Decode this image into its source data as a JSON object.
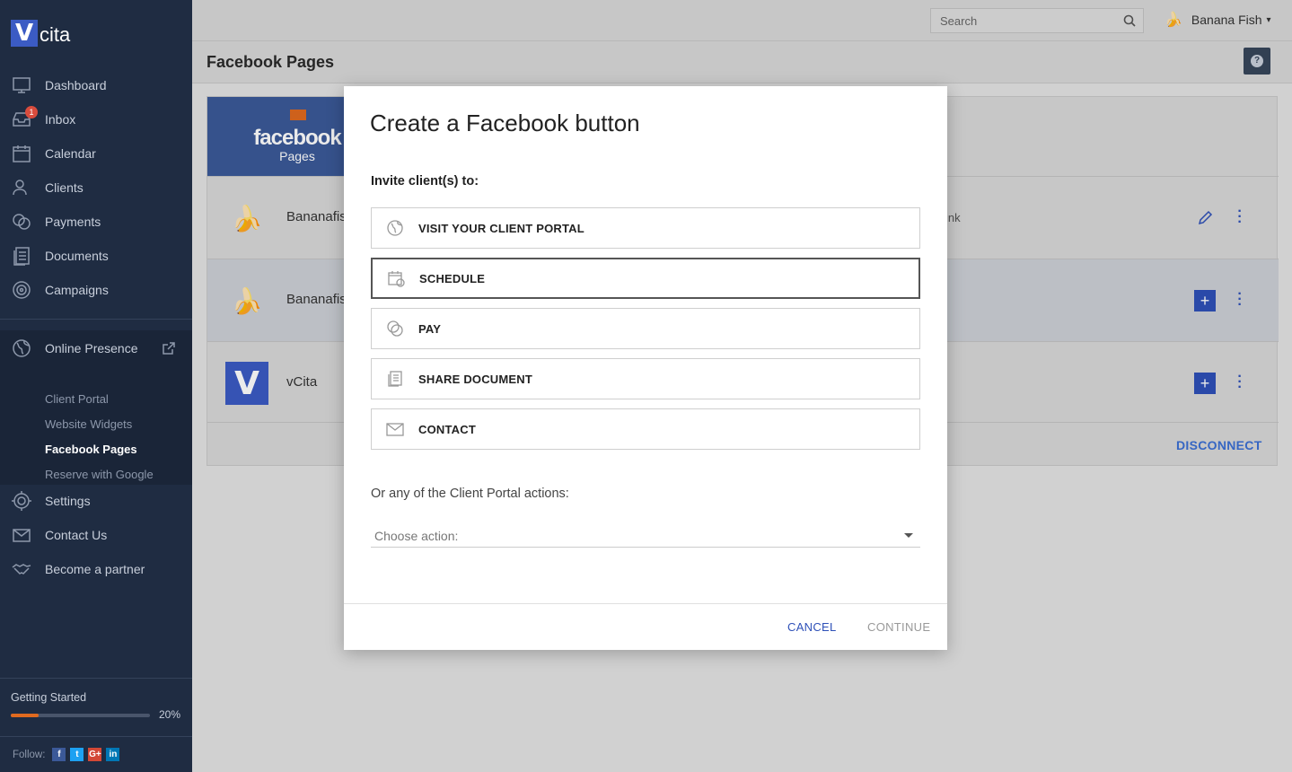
{
  "brand": {
    "logo_letter": "V",
    "logo_text": "cita",
    "accent": "#3b5bc4"
  },
  "sidebar": {
    "items": [
      {
        "label": "Dashboard",
        "icon": "dashboard-icon"
      },
      {
        "label": "Inbox",
        "icon": "inbox-icon",
        "badge": "1"
      },
      {
        "label": "Calendar",
        "icon": "calendar-icon"
      },
      {
        "label": "Clients",
        "icon": "clients-icon"
      },
      {
        "label": "Payments",
        "icon": "payments-icon"
      },
      {
        "label": "Documents",
        "icon": "documents-icon"
      },
      {
        "label": "Campaigns",
        "icon": "campaigns-icon"
      }
    ],
    "online_presence": {
      "label": "Online Presence",
      "subitems": [
        "Client Portal",
        "Website Widgets",
        "Facebook Pages",
        "Reserve with Google"
      ],
      "active": "Facebook Pages"
    },
    "bottom_items": [
      {
        "label": "Settings",
        "icon": "settings-icon"
      },
      {
        "label": "Contact Us",
        "icon": "mail-icon"
      },
      {
        "label": "Become a partner",
        "icon": "handshake-icon"
      }
    ],
    "getting_started": {
      "label": "Getting Started",
      "percent": "20%",
      "progress": 0.2
    },
    "follow": {
      "label": "Follow:",
      "networks": [
        "f",
        "t",
        "G+",
        "in"
      ]
    }
  },
  "topbar": {
    "search_placeholder": "Search",
    "user_name": "Banana Fish"
  },
  "page": {
    "title": "Facebook Pages",
    "help": "?",
    "fb_header": {
      "word": "facebook",
      "sub": "Pages"
    },
    "rows": [
      {
        "name": "Bananafis",
        "extra": "ink",
        "thumb": "🍌",
        "action": "edit"
      },
      {
        "name": "Bananafis",
        "extra": "",
        "thumb": "🍌",
        "action": "add"
      },
      {
        "name": "vCita",
        "extra": "",
        "thumb": "V",
        "action": "add"
      }
    ],
    "disconnect": "DISCONNECT"
  },
  "modal": {
    "title": "Create a Facebook button",
    "subtitle": "Invite client(s) to:",
    "options": [
      {
        "label": "VISIT YOUR CLIENT PORTAL",
        "icon": "globe-icon"
      },
      {
        "label": "SCHEDULE",
        "icon": "calendar-icon",
        "selected": true
      },
      {
        "label": "PAY",
        "icon": "coins-icon"
      },
      {
        "label": "SHARE DOCUMENT",
        "icon": "document-icon"
      },
      {
        "label": "CONTACT",
        "icon": "envelope-icon"
      }
    ],
    "or_text": "Or any of the Client Portal actions:",
    "select_placeholder": "Choose action:",
    "cancel": "CANCEL",
    "continue": "CONTINUE"
  }
}
